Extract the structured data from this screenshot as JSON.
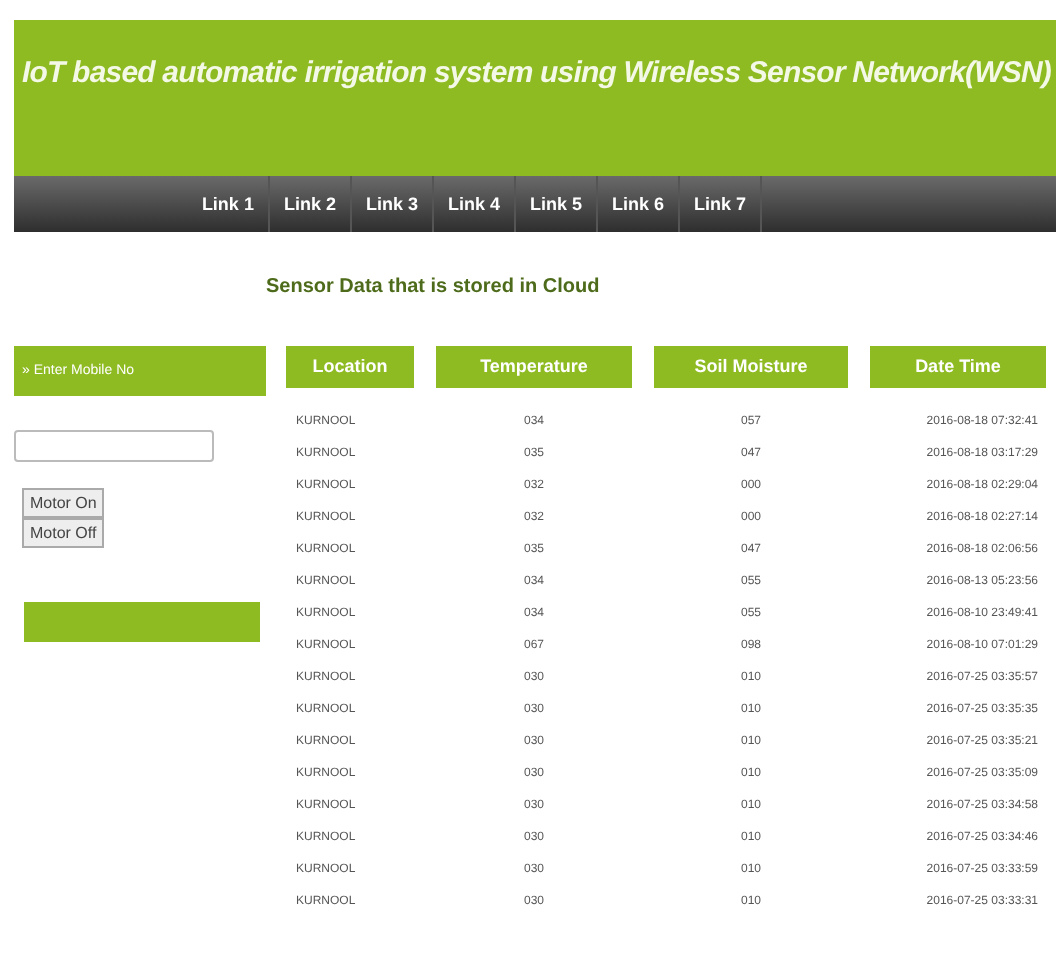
{
  "header": {
    "title": "IoT based automatic irrigation system using Wireless Sensor Network(WSN)"
  },
  "nav": [
    "Link 1",
    "Link 2",
    "Link 3",
    "Link 4",
    "Link 5",
    "Link 6",
    "Link 7"
  ],
  "heading": "Sensor Data that is stored in Cloud",
  "sidebar": {
    "label": "» Enter Mobile No",
    "buttons": [
      "Motor On",
      "Motor Off"
    ]
  },
  "table": {
    "columns": [
      "Location",
      "Temperature",
      "Soil Moisture",
      "Date Time"
    ],
    "rows": [
      [
        "KURNOOL",
        "034",
        "057",
        "2016-08-18 07:32:41"
      ],
      [
        "KURNOOL",
        "035",
        "047",
        "2016-08-18 03:17:29"
      ],
      [
        "KURNOOL",
        "032",
        "000",
        "2016-08-18 02:29:04"
      ],
      [
        "KURNOOL",
        "032",
        "000",
        "2016-08-18 02:27:14"
      ],
      [
        "KURNOOL",
        "035",
        "047",
        "2016-08-18 02:06:56"
      ],
      [
        "KURNOOL",
        "034",
        "055",
        "2016-08-13 05:23:56"
      ],
      [
        "KURNOOL",
        "034",
        "055",
        "2016-08-10 23:49:41"
      ],
      [
        "KURNOOL",
        "067",
        "098",
        "2016-08-10 07:01:29"
      ],
      [
        "KURNOOL",
        "030",
        "010",
        "2016-07-25 03:35:57"
      ],
      [
        "KURNOOL",
        "030",
        "010",
        "2016-07-25 03:35:35"
      ],
      [
        "KURNOOL",
        "030",
        "010",
        "2016-07-25 03:35:21"
      ],
      [
        "KURNOOL",
        "030",
        "010",
        "2016-07-25 03:35:09"
      ],
      [
        "KURNOOL",
        "030",
        "010",
        "2016-07-25 03:34:58"
      ],
      [
        "KURNOOL",
        "030",
        "010",
        "2016-07-25 03:34:46"
      ],
      [
        "KURNOOL",
        "030",
        "010",
        "2016-07-25 03:33:59"
      ],
      [
        "KURNOOL",
        "030",
        "010",
        "2016-07-25 03:33:31"
      ]
    ]
  }
}
